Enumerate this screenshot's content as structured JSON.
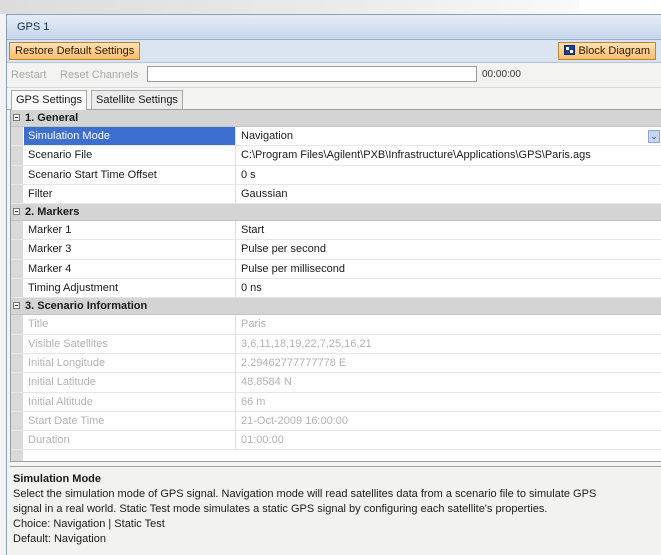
{
  "window": {
    "title": "GPS 1"
  },
  "toolbar": {
    "restore_label": "Restore Default Settings",
    "block_diagram_label": "Block Diagram"
  },
  "controls": {
    "restart_label": "Restart",
    "reset_channels_label": "Reset Channels",
    "progress": 0.0,
    "elapsed_time": "00:00:00"
  },
  "tabs": [
    {
      "label": "GPS Settings",
      "active": true
    },
    {
      "label": "Satellite Settings",
      "active": false
    }
  ],
  "sections": {
    "general": {
      "title": "1. General",
      "rows": [
        {
          "name": "Simulation Mode",
          "value": "Navigation"
        },
        {
          "name": "Scenario File",
          "value": "C:\\Program Files\\Agilent\\PXB\\Infrastructure\\Applications\\GPS\\Paris.ags"
        },
        {
          "name": "Scenario Start Time Offset",
          "value": "0 s"
        },
        {
          "name": "Filter",
          "value": "Gaussian"
        }
      ]
    },
    "markers": {
      "title": "2. Markers",
      "rows": [
        {
          "name": "Marker 1",
          "value": "Start"
        },
        {
          "name": "Marker 3",
          "value": "Pulse per second"
        },
        {
          "name": "Marker 4",
          "value": "Pulse per millisecond"
        },
        {
          "name": "Timing Adjustment",
          "value": "0 ns"
        }
      ]
    },
    "scenario": {
      "title": "3. Scenario Information",
      "rows": [
        {
          "name": "Title",
          "value": "Paris"
        },
        {
          "name": "Visible Satellites",
          "value": "3,6,11,18,19,22,7,25,16,21"
        },
        {
          "name": "Initial Longitude",
          "value": "2.29462777777778 E"
        },
        {
          "name": "Initial Latitude",
          "value": "48.8584 N"
        },
        {
          "name": "Initial Altitude",
          "value": "66 m"
        },
        {
          "name": "Start Date Time",
          "value": "21-Oct-2009 16:00:00"
        },
        {
          "name": "Duration",
          "value": "01:00:00"
        }
      ]
    }
  },
  "help": {
    "title": "Simulation Mode",
    "line1": "Select the simulation mode of GPS signal. Navigation mode will read satellites data from a scenario file to simulate GPS",
    "line2": "signal in a real world. Static Test mode simulates a static GPS signal by configuring each satellite's properties.",
    "line3": "Choice: Navigation | Static Test",
    "line4": "Default: Navigation"
  },
  "colors": {
    "accent_orange": "#f8be6c",
    "selection_blue": "#3c6fd0",
    "title_blue": "#c7d6ec"
  },
  "icons": {
    "dropdown": "chevron-down-icon",
    "block_diagram": "block-diagram-icon",
    "collapse": "minus-box-icon"
  }
}
